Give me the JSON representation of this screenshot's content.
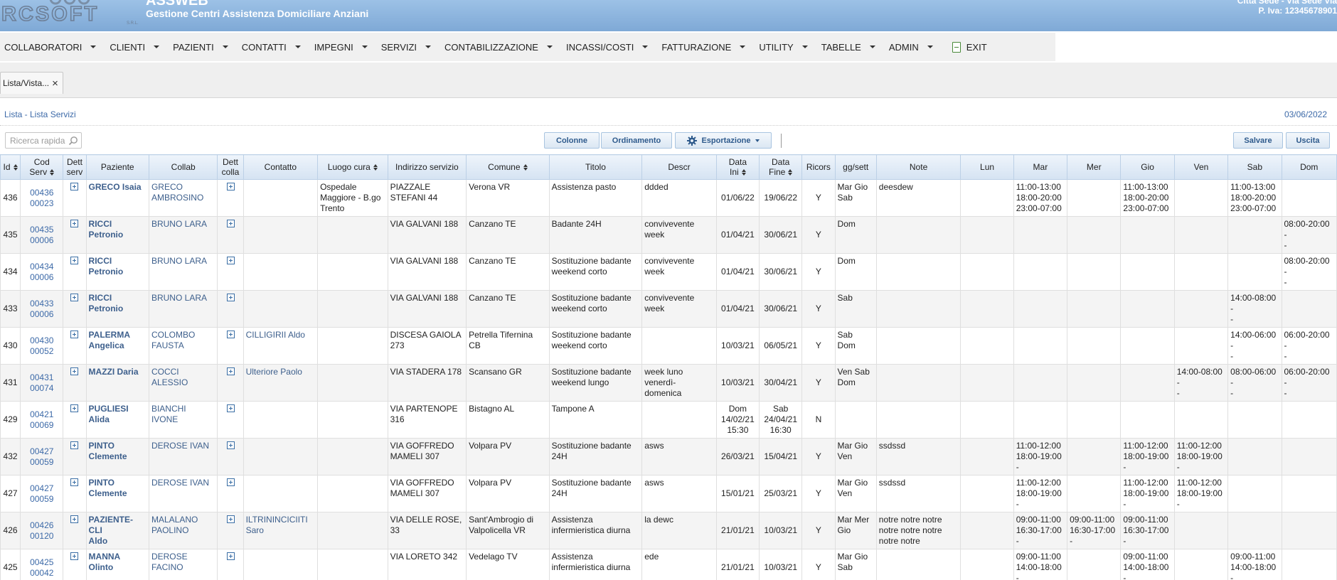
{
  "app": {
    "title": "ASSWEB",
    "subtitle": "Gestione Centri Assistenza Domiciliare Anziani",
    "logo_text": "RCSOFT",
    "logo_suffix": "S.R.L.",
    "company_line1": "Città Sede - Via Sede Via",
    "company_line2": "P. Iva: 12345678901"
  },
  "menu": [
    {
      "id": "collaboratori",
      "label": "COLLABORATORI"
    },
    {
      "id": "clienti",
      "label": "CLIENTI"
    },
    {
      "id": "pazienti",
      "label": "PAZIENTI"
    },
    {
      "id": "contatti",
      "label": "CONTATTI"
    },
    {
      "id": "impegni",
      "label": "IMPEGNI"
    },
    {
      "id": "servizi",
      "label": "SERVIZI"
    },
    {
      "id": "contabilizzazione",
      "label": "CONTABILIZZAZIONE"
    },
    {
      "id": "incassi",
      "label": "INCASSI/COSTI"
    },
    {
      "id": "fatturazione",
      "label": "FATTURAZIONE"
    },
    {
      "id": "utility",
      "label": "UTILITY"
    },
    {
      "id": "tabelle",
      "label": "TABELLE"
    },
    {
      "id": "admin",
      "label": "ADMIN"
    }
  ],
  "exit_label": "EXIT",
  "tab": {
    "label": "Lista/Vista...",
    "close": "×"
  },
  "page": {
    "title": "Lista - Lista Servizi",
    "date": "03/06/2022"
  },
  "toolbar": {
    "search_placeholder": "Ricerca rapida",
    "colonne": "Colonne",
    "ordinamento": "Ordinamento",
    "esportazione": "Esportazione",
    "salvare": "Salvare",
    "uscita": "Uscita"
  },
  "table": {
    "headers": {
      "id": "Id",
      "cod": "Cod\nServ",
      "dett_serv": "Dett\nserv",
      "paziente": "Paziente",
      "collab": "Collab",
      "dett_colla": "Dett\ncolla",
      "contatto": "Contatto",
      "luogo": "Luogo cura",
      "indirizzo": "Indirizzo servizio",
      "comune": "Comune",
      "titolo": "Titolo",
      "descr": "Descr",
      "data_ini": "Data\nIni",
      "data_fine": "Data\nFine",
      "ricors": "Ricors",
      "gg": "gg/sett",
      "note": "Note",
      "lun": "Lun",
      "mar": "Mar",
      "mer": "Mer",
      "gio": "Gio",
      "ven": "Ven",
      "sab": "Sab",
      "dom": "Dom"
    },
    "rows": [
      {
        "id": "436",
        "cod": "00436\n00023",
        "paziente": "GRECO Isaia",
        "collab": "GRECO\nAMBROSINO",
        "contatto": "",
        "luogo": "Ospedale\nMaggiore - B.go\nTrento",
        "indirizzo": "PIAZZALE\nSTEFANI 44",
        "comune": "Verona VR",
        "titolo": "Assistenza pasto",
        "descr": "ddded",
        "data_ini": "01/06/22",
        "data_fine": "19/06/22",
        "ricors": "Y",
        "gg": "Mar Gio\nSab",
        "note": "deesdew",
        "lun": "",
        "mar": "11:00-13:00\n18:00-20:00\n23:00-07:00",
        "mer": "",
        "gio": "11:00-13:00\n18:00-20:00\n23:00-07:00",
        "ven": "",
        "sab": "11:00-13:00\n18:00-20:00\n23:00-07:00",
        "dom": ""
      },
      {
        "id": "435",
        "cod": "00435\n00006",
        "paziente": "RICCI\nPetronio",
        "collab": "BRUNO LARA",
        "contatto": "",
        "luogo": "",
        "indirizzo": "VIA GALVANI 188",
        "comune": "Canzano TE",
        "titolo": "Badante 24H",
        "descr": "convivevente\nweek",
        "data_ini": "01/04/21",
        "data_fine": "30/06/21",
        "ricors": "Y",
        "gg": "Dom",
        "note": "",
        "lun": "",
        "mar": "",
        "mer": "",
        "gio": "",
        "ven": "",
        "sab": "",
        "dom": "08:00-20:00\n-\n-"
      },
      {
        "id": "434",
        "cod": "00434\n00006",
        "paziente": "RICCI\nPetronio",
        "collab": "BRUNO LARA",
        "contatto": "",
        "luogo": "",
        "indirizzo": "VIA GALVANI 188",
        "comune": "Canzano TE",
        "titolo": "Sostituzione badante\nweekend corto",
        "descr": "convivevente\nweek",
        "data_ini": "01/04/21",
        "data_fine": "30/06/21",
        "ricors": "Y",
        "gg": "Dom",
        "note": "",
        "lun": "",
        "mar": "",
        "mer": "",
        "gio": "",
        "ven": "",
        "sab": "",
        "dom": "08:00-20:00\n-\n-"
      },
      {
        "id": "433",
        "cod": "00433\n00006",
        "paziente": "RICCI\nPetronio",
        "collab": "BRUNO LARA",
        "contatto": "",
        "luogo": "",
        "indirizzo": "VIA GALVANI 188",
        "comune": "Canzano TE",
        "titolo": "Sostituzione badante\nweekend corto",
        "descr": "convivevente\nweek",
        "data_ini": "01/04/21",
        "data_fine": "30/06/21",
        "ricors": "Y",
        "gg": "Sab",
        "note": "",
        "lun": "",
        "mar": "",
        "mer": "",
        "gio": "",
        "ven": "",
        "sab": "14:00-08:00\n-\n-",
        "dom": ""
      },
      {
        "id": "430",
        "cod": "00430\n00052",
        "paziente": "PALERMA\nAngelica",
        "collab": "COLOMBO\nFAUSTA",
        "contatto": "CILLIGIRII Aldo",
        "luogo": "",
        "indirizzo": "DISCESA GAIOLA\n273",
        "comune": "Petrella Tifernina\nCB",
        "titolo": "Sostituzione badante\nweekend corto",
        "descr": "",
        "data_ini": "10/03/21",
        "data_fine": "06/05/21",
        "ricors": "Y",
        "gg": "Sab\nDom",
        "note": "",
        "lun": "",
        "mar": "",
        "mer": "",
        "gio": "",
        "ven": "",
        "sab": "14:00-06:00\n-\n-",
        "dom": "06:00-20:00\n-\n-"
      },
      {
        "id": "431",
        "cod": "00431\n00074",
        "paziente": "MAZZI Daria",
        "collab": "COCCI\nALESSIO",
        "contatto": "Ulteriore Paolo",
        "luogo": "",
        "indirizzo": "VIA STADERA 178",
        "comune": "Scansano GR",
        "titolo": "Sostituzione badante\nweekend lungo",
        "descr": "week luno\nvenerdì-\ndomenica",
        "data_ini": "10/03/21",
        "data_fine": "30/04/21",
        "ricors": "Y",
        "gg": "Ven Sab\nDom",
        "note": "",
        "lun": "",
        "mar": "",
        "mer": "",
        "gio": "",
        "ven": "14:00-08:00\n-\n-",
        "sab": "08:00-06:00\n-\n-",
        "dom": "06:00-20:00\n-\n-"
      },
      {
        "id": "429",
        "cod": "00421\n00069",
        "paziente": "PUGLIESI\nAlida",
        "collab": "BIANCHI\nIVONE",
        "contatto": "",
        "luogo": "",
        "indirizzo": "VIA PARTENOPE\n316",
        "comune": "Bistagno AL",
        "titolo": "Tampone A",
        "descr": "",
        "data_ini": "Dom\n14/02/21\n15:30",
        "data_fine": "Sab\n24/04/21\n16:30",
        "ricors": "N",
        "gg": "",
        "note": "",
        "lun": "",
        "mar": "",
        "mer": "",
        "gio": "",
        "ven": "",
        "sab": "",
        "dom": ""
      },
      {
        "id": "432",
        "cod": "00427\n00059",
        "paziente": "PINTO\nClemente",
        "collab": "DEROSE IVAN",
        "contatto": "",
        "luogo": "",
        "indirizzo": "VIA GOFFREDO\nMAMELI 307",
        "comune": "Volpara PV",
        "titolo": "Sostituzione badante\n24H",
        "descr": "asws",
        "data_ini": "26/03/21",
        "data_fine": "15/04/21",
        "ricors": "Y",
        "gg": "Mar Gio\nVen",
        "note": "ssdssd",
        "lun": "",
        "mar": "11:00-12:00\n18:00-19:00\n-",
        "mer": "",
        "gio": "11:00-12:00\n18:00-19:00\n-",
        "ven": "11:00-12:00\n18:00-19:00\n-",
        "sab": "",
        "dom": ""
      },
      {
        "id": "427",
        "cod": "00427\n00059",
        "paziente": "PINTO\nClemente",
        "collab": "DEROSE IVAN",
        "contatto": "",
        "luogo": "",
        "indirizzo": "VIA GOFFREDO\nMAMELI 307",
        "comune": "Volpara PV",
        "titolo": "Sostituzione badante\n24H",
        "descr": "asws",
        "data_ini": "15/01/21",
        "data_fine": "25/03/21",
        "ricors": "Y",
        "gg": "Mar Gio\nVen",
        "note": "ssdssd",
        "lun": "",
        "mar": "11:00-12:00\n18:00-19:00\n-",
        "mer": "",
        "gio": "11:00-12:00\n18:00-19:00\n-",
        "ven": "11:00-12:00\n18:00-19:00\n-",
        "sab": "",
        "dom": ""
      },
      {
        "id": "426",
        "cod": "00426\n00120",
        "paziente": "PAZIENTE-CLI\nAldo",
        "collab": "MALALANO\nPAOLINO",
        "contatto": "ILTRININCICIITI\nSaro",
        "luogo": "",
        "indirizzo": "VIA DELLE ROSE,\n33",
        "comune": "Sant'Ambrogio di\nValpolicella VR",
        "titolo": "Assistenza\ninfermieristica diurna",
        "descr": "la dewc",
        "data_ini": "21/01/21",
        "data_fine": "10/03/21",
        "ricors": "Y",
        "gg": "Mar Mer\nGio",
        "note": "notre notre notre\nnotre notre notre\nnotre notre",
        "lun": "",
        "mar": "09:00-11:00\n16:30-17:00\n-",
        "mer": "09:00-11:00\n16:30-17:00\n-",
        "gio": "09:00-11:00\n16:30-17:00\n-",
        "ven": "",
        "sab": "",
        "dom": ""
      },
      {
        "id": "425",
        "cod": "00425\n00042",
        "paziente": "MANNA Olinto",
        "collab": "DEROSE\nFACINO",
        "contatto": "",
        "luogo": "",
        "indirizzo": "VIA LORETO 342",
        "comune": "Vedelago TV",
        "titolo": "Assistenza\ninfermieristica diurna",
        "descr": "ede",
        "data_ini": "21/01/21",
        "data_fine": "10/03/21",
        "ricors": "Y",
        "gg": "Mar Gio\nSab",
        "note": "",
        "lun": "",
        "mar": "09:00-11:00\n14:00-18:00\n-",
        "mer": "",
        "gio": "09:00-11:00\n14:00-18:00\n-",
        "ven": "",
        "sab": "09:00-11:00\n14:00-18:00\n-",
        "dom": ""
      }
    ]
  }
}
